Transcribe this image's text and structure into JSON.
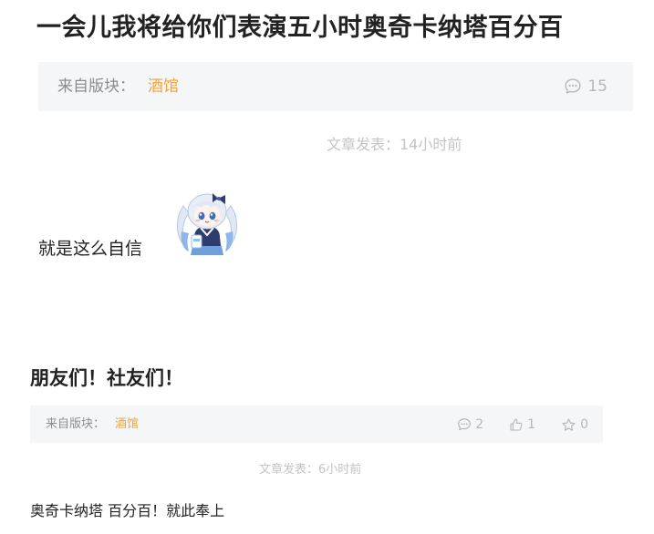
{
  "post1": {
    "title": "一会儿我将给你们表演五小时奥奇卡纳塔百分百",
    "from_label": "来自版块：",
    "from_value": "酒馆",
    "comment_count": "15",
    "time_text": "文章发表：14小时前",
    "body_text": "就是这么自信",
    "sticker_icon": "chibi-anime-girl-sticker"
  },
  "post2": {
    "title": "朋友们！社友们！",
    "from_label": "来自版块：",
    "from_value": "酒馆",
    "comment_count": "2",
    "like_count": "1",
    "star_count": "0",
    "time_text": "文章发表：6小时前",
    "body_text": "奥奇卡纳塔 百分百！就此奉上"
  },
  "colors": {
    "accent": "#f0a53c",
    "meta_bg": "#f5f6f8",
    "muted": "#b8b8b8",
    "text": "#222222"
  }
}
